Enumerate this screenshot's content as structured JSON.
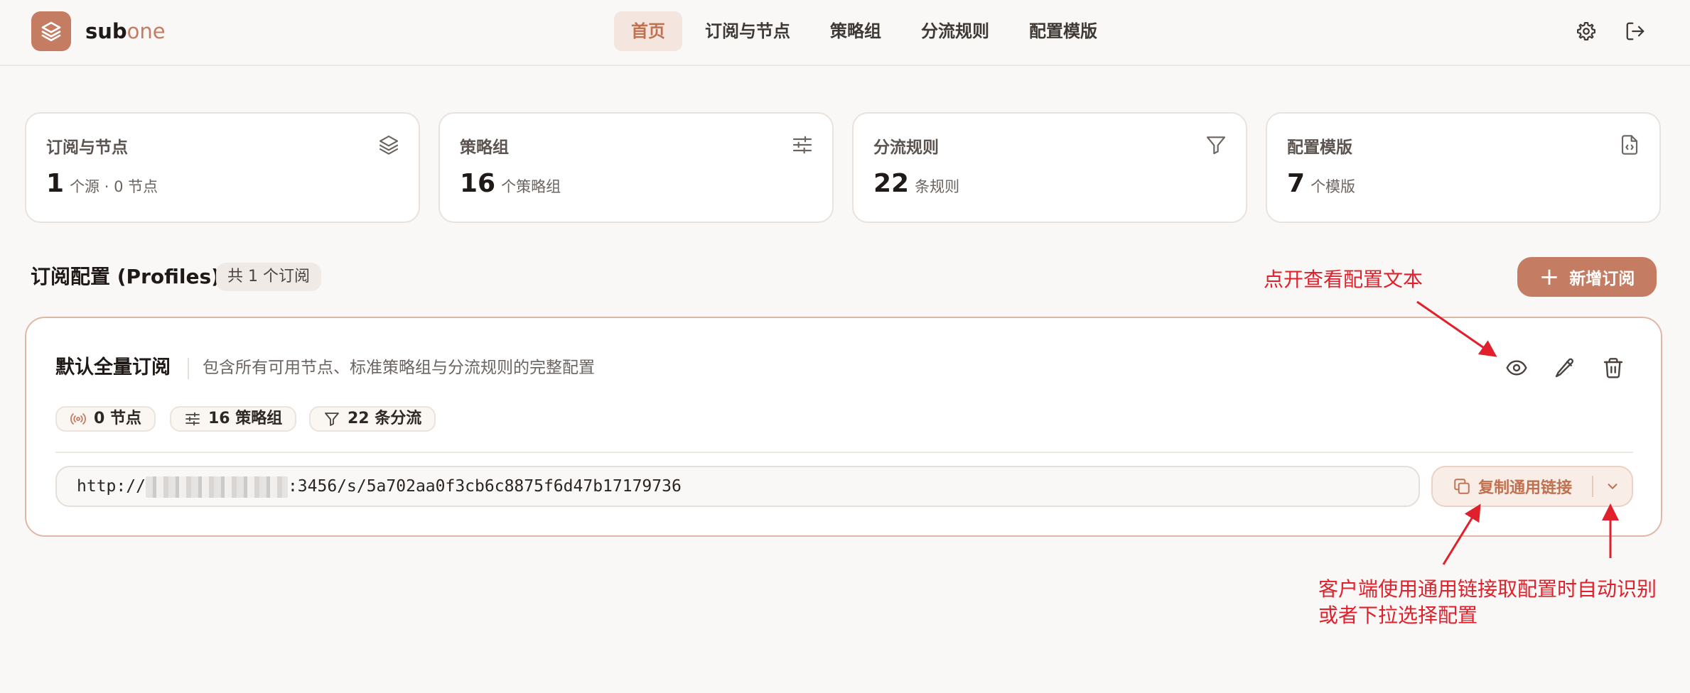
{
  "brand": {
    "bold": "sub",
    "light": "one"
  },
  "nav": {
    "items": [
      {
        "label": "首页",
        "active": true
      },
      {
        "label": "订阅与节点",
        "active": false
      },
      {
        "label": "策略组",
        "active": false
      },
      {
        "label": "分流规则",
        "active": false
      },
      {
        "label": "配置模版",
        "active": false
      }
    ]
  },
  "header_icons": [
    "gear-icon",
    "logout-icon"
  ],
  "stats": [
    {
      "title": "订阅与节点",
      "value": "1",
      "unit": "个源 · 0 节点",
      "icon": "layers-icon"
    },
    {
      "title": "策略组",
      "value": "16",
      "unit": "个策略组",
      "icon": "sliders-icon"
    },
    {
      "title": "分流规则",
      "value": "22",
      "unit": "条规则",
      "icon": "filter-icon"
    },
    {
      "title": "配置模版",
      "value": "7",
      "unit": "个模版",
      "icon": "file-code-icon"
    }
  ],
  "section": {
    "title": "订阅配置 (Profiles)",
    "count_badge": "共 1 个订阅",
    "add_button": "新增订阅"
  },
  "profile": {
    "name": "默认全量订阅",
    "description": "包含所有可用节点、标准策略组与分流规则的完整配置",
    "chips": [
      {
        "label": "0 节点",
        "icon": "broadcast-icon"
      },
      {
        "label": "16 策略组",
        "icon": "sliders-icon"
      },
      {
        "label": "22 条分流",
        "icon": "filter-icon"
      }
    ],
    "url_prefix": "http://",
    "url_suffix": ":3456/s/5a702aa0f3cb6c8875f6d47b17179736",
    "copy_button": "复制通用链接"
  },
  "annotations": {
    "view_hint": "点开查看配置文本",
    "copy_hint_line1": "客户端使用通用链接取配置时自动识别",
    "copy_hint_line2": "或者下拉选择配置"
  },
  "colors": {
    "accent": "#c47c62",
    "accent_text": "#c0714f",
    "background": "#f9f8f6",
    "annotation_red": "#e0202a"
  }
}
